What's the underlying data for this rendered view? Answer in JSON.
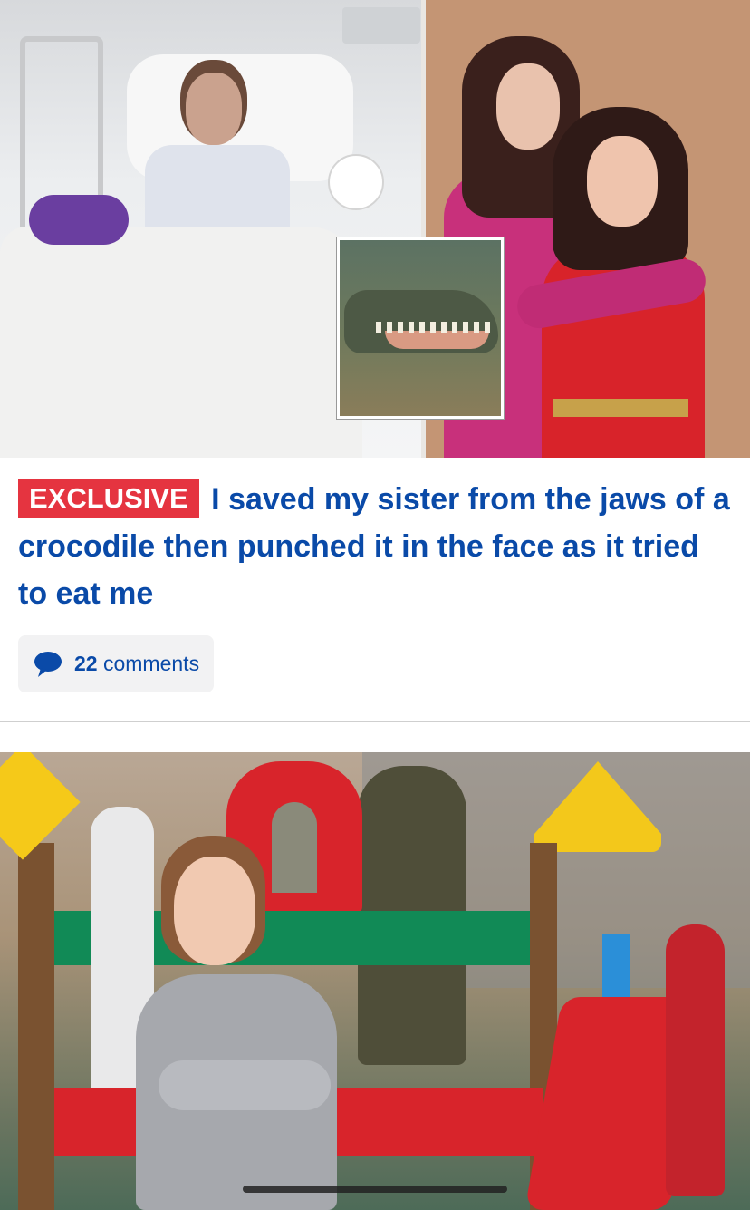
{
  "hero": {
    "left_photo": "hospital-bed-photo",
    "right_photo": "sisters-portrait-photo",
    "inset_photo": "crocodile-photo"
  },
  "article": {
    "badge": "EXCLUSIVE",
    "headline": "I saved my sister from the jaws of a crocodile then punched it in the face as it tried to eat me",
    "comments": {
      "count": "22",
      "label": "comments",
      "icon": "comment-bubble-icon"
    }
  },
  "next_article": {
    "photo": "playground-girl-photo"
  },
  "colors": {
    "headline": "#0a4aa8",
    "badge_bg": "#e53440",
    "badge_text": "#ffffff",
    "comments_bg": "#f2f2f3"
  }
}
